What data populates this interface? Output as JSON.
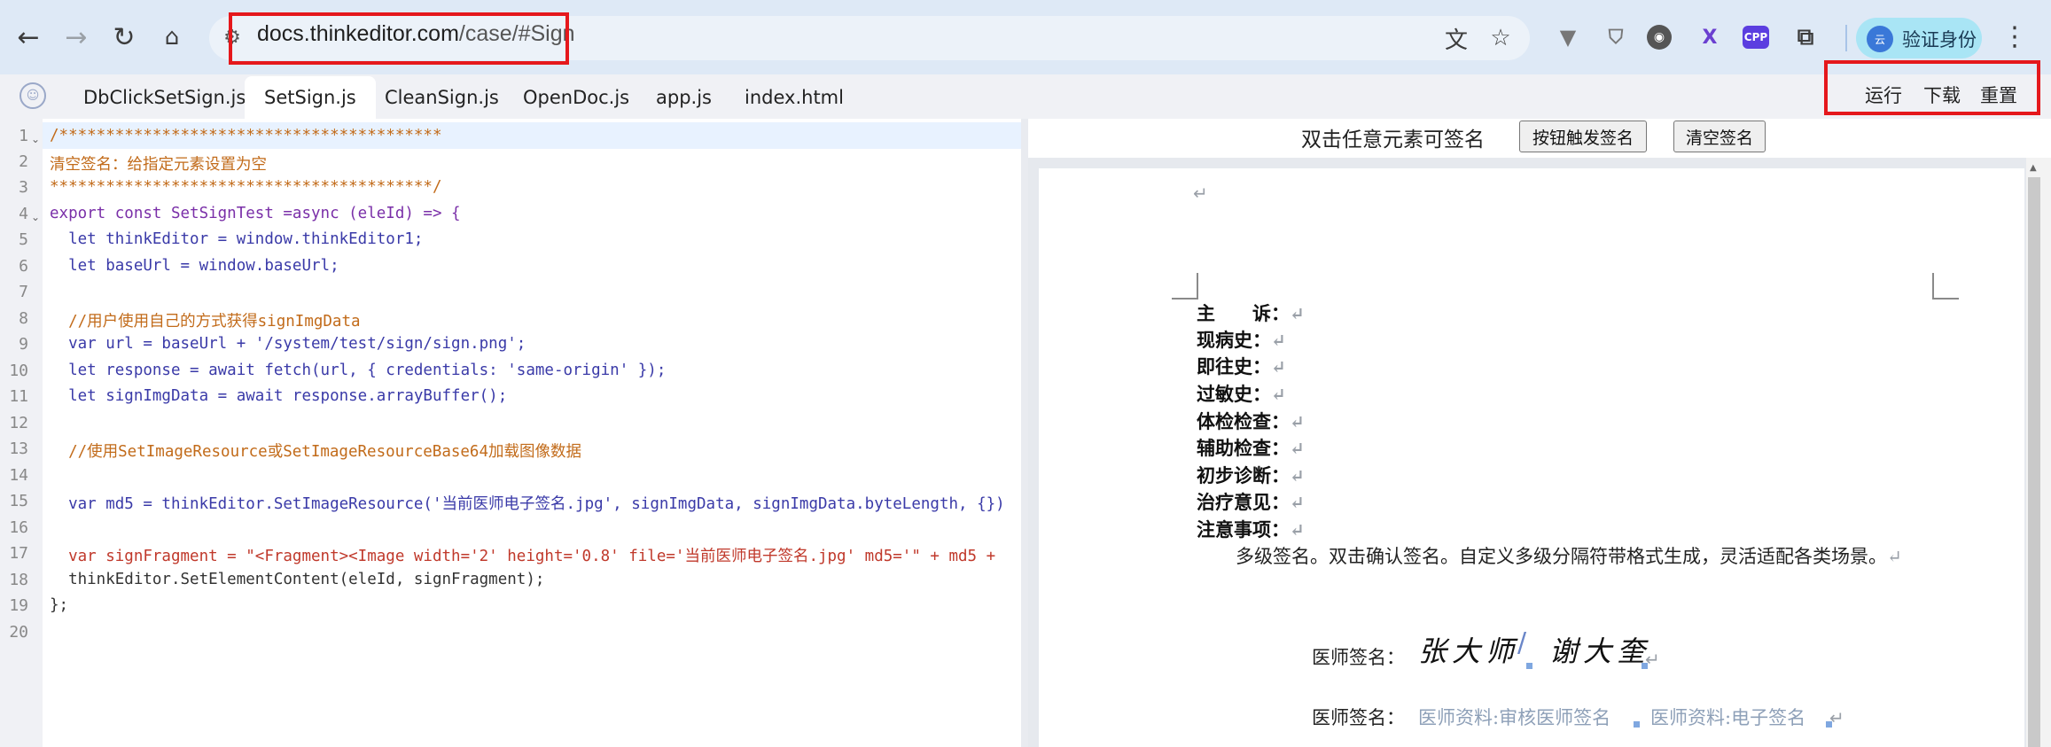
{
  "browser": {
    "url_host": "docs.thinkeditor.com",
    "url_path": "/case/#Sign",
    "profile_label": "验证身份",
    "profile_avatar": "云",
    "extensions": [
      "vee-icon",
      "shield-icon",
      "camera-icon",
      "x-icon",
      "cpp-icon",
      "puzzle-icon"
    ],
    "ext_cpp_label": "CPP",
    "ext_x_label": "X"
  },
  "tabs": [
    {
      "label": "DbClickSetSign.js",
      "active": false
    },
    {
      "label": "SetSign.js",
      "active": true
    },
    {
      "label": "CleanSign.js",
      "active": false
    },
    {
      "label": "OpenDoc.js",
      "active": false
    },
    {
      "label": "app.js",
      "active": false
    },
    {
      "label": "index.html",
      "active": false
    }
  ],
  "actions": {
    "run": "运行",
    "download": "下载",
    "reset": "重置"
  },
  "editor": {
    "line_numbers": [
      "1",
      "2",
      "3",
      "4",
      "5",
      "6",
      "7",
      "8",
      "9",
      "10",
      "11",
      "12",
      "13",
      "14",
      "15",
      "16",
      "17",
      "18",
      "19",
      "20"
    ],
    "lines": [
      "/*****************************************",
      "清空签名：给指定元素设置为空",
      "*****************************************/",
      "export const SetSignTest =async (eleId) => {",
      "  let thinkEditor = window.thinkEditor1;",
      "  let baseUrl = window.baseUrl;",
      "",
      "  //用户使用自己的方式获得signImgData",
      "  var url = baseUrl + '/system/test/sign/sign.png';",
      "  let response = await fetch(url, { credentials: 'same-origin' });",
      "  let signImgData = await response.arrayBuffer();",
      "",
      "  //使用SetImageResource或SetImageResourceBase64加载图像数据",
      "",
      "  var md5 = thinkEditor.SetImageResource('当前医师电子签名.jpg', signImgData, signImgData.byteLength, {})",
      "",
      "  var signFragment = \"<Fragment><Image width='2' height='0.8' file='当前医师电子签名.jpg' md5='\" + md5 +",
      "  thinkEditor.SetElementContent(eleId, signFragment);",
      "};",
      ""
    ]
  },
  "preview": {
    "title": "双击任意元素可签名",
    "btn_trigger": "按钮触发签名",
    "btn_clear": "清空签名",
    "return_mark": "↵",
    "fields": [
      "主　　诉：",
      "现病史：",
      "即往史：",
      "过敏史：",
      "体检检查：",
      "辅助检查：",
      "初步诊断：",
      "治疗意见：",
      "注意事项："
    ],
    "paragraph": "多级签名。双击确认签名。自定义多级分隔符带格式生成，灵活适配各类场景。",
    "sig_label_1": "医师签名：",
    "sig_name_1": "张大师",
    "sig_sep": "/",
    "sig_name_2": "谢大奎",
    "sig_label_2": "医师签名：",
    "sig_placeholder_1": "医师资料:审核医师签名",
    "sig_placeholder_2": "医师资料:电子签名"
  }
}
